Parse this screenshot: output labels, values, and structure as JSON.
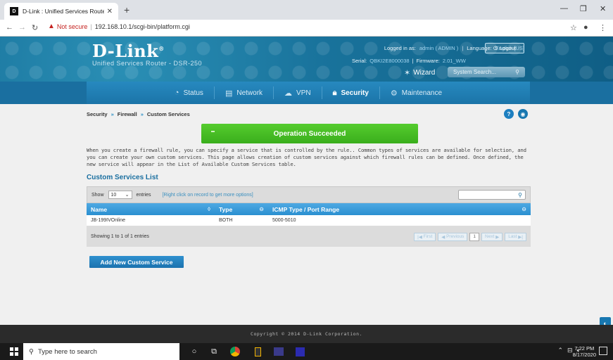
{
  "browser": {
    "tab_title": "D-Link : Unified Services Router",
    "url_warning": "Not secure",
    "url": "192.168.10.1/scgi-bin/platform.cgi"
  },
  "header": {
    "logo": "D-Link",
    "product": "Unified Services Router - DSR-250",
    "logged_in_label": "Logged in as:",
    "logged_in_value": "admin ( ADMIN )",
    "language_label": "Language:",
    "language_value": "English [US]",
    "logout": "Logout",
    "serial_label": "Serial:",
    "serial_value": "QBKI2E8000038",
    "firmware_label": "Firmware:",
    "firmware_value": "2.01_WW",
    "wizard": "Wizard",
    "search_placeholder": "System Search..."
  },
  "nav": [
    {
      "label": "Status",
      "icon": "gauge-icon"
    },
    {
      "label": "Network",
      "icon": "monitor-icon"
    },
    {
      "label": "VPN",
      "icon": "cloud-icon"
    },
    {
      "label": "Security",
      "icon": "lock-icon",
      "active": true
    },
    {
      "label": "Maintenance",
      "icon": "gears-icon"
    }
  ],
  "breadcrumb": [
    "Security",
    "Firewall",
    "Custom Services"
  ],
  "success_message": "Operation Succeeded",
  "description": "When you create a firewall rule, you can specify a service that is controlled by the rule.. Common types of services are available for selection, and you can create your own custom services. This page allows creation of custom services against which firewall rules can be defined. Once defined, the new service will appear in the List of Available Custom Services table.",
  "list_title": "Custom Services List",
  "table": {
    "show_label": "Show",
    "show_value": "10",
    "entries_label": "entries",
    "right_click_hint": "[Right click on record to get more options]",
    "columns": [
      "Name",
      "Type",
      "ICMP Type / Port Range"
    ],
    "rows": [
      [
        "JB-199IVOnline",
        "BOTH",
        "5000-5010"
      ]
    ],
    "info": "Showing 1 to 1 of 1 entries",
    "pager": {
      "first": "First",
      "previous": "Previous",
      "page": "1",
      "next": "Next",
      "last": "Last"
    }
  },
  "add_button": "Add New Custom Service",
  "footer": "Copyright © 2014 D-Link Corporation.",
  "taskbar": {
    "search": "Type here to search",
    "time": "7:22 PM",
    "date": "8/17/2020"
  }
}
